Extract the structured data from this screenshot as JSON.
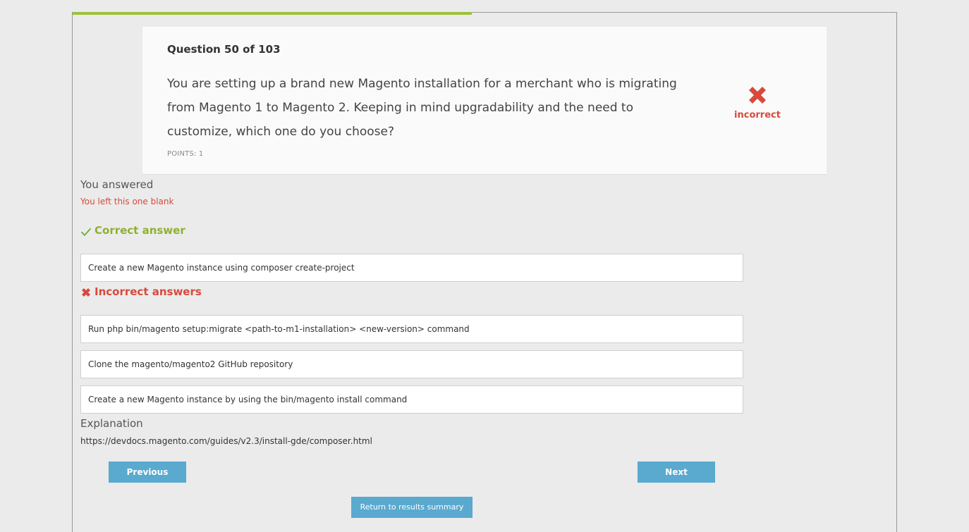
{
  "quiz": {
    "progress_fraction": 0.485,
    "question_number": "Question 50 of 103",
    "question_text": "You are setting up a brand new Magento installation for a merchant who is migrating from Magento 1 to Magento 2. Keeping in mind upgradability and the need to customize, which one do you choose?",
    "points": "POINTS: 1",
    "status": "incorrect",
    "status_icon": "red-x-icon"
  },
  "response": {
    "answered_label": "You answered",
    "answered_value": "You left this one blank"
  },
  "correct": {
    "heading": "Correct answer",
    "icon": "checkmark-icon",
    "answers": [
      "Create a new Magento instance using composer create-project"
    ]
  },
  "incorrect": {
    "heading": "Incorrect answers",
    "icon": "red-x-icon",
    "answers": [
      "Run php bin/magento setup:migrate <path-to-m1-installation> <new-version> command",
      "Clone the magento/magento2 GitHub repository",
      "Create a new Magento instance by using the bin/magento install command"
    ]
  },
  "explanation": {
    "label": "Explanation",
    "text": "https://devdocs.magento.com/guides/v2.3/install-gde/composer.html"
  },
  "buttons": {
    "previous": "Previous",
    "next": "Next",
    "summary": "Return to results summary"
  },
  "colors": {
    "progress": "#9fc03a",
    "correct": "#8fb02f",
    "incorrect": "#d9493c",
    "button": "#5aa9cf"
  }
}
